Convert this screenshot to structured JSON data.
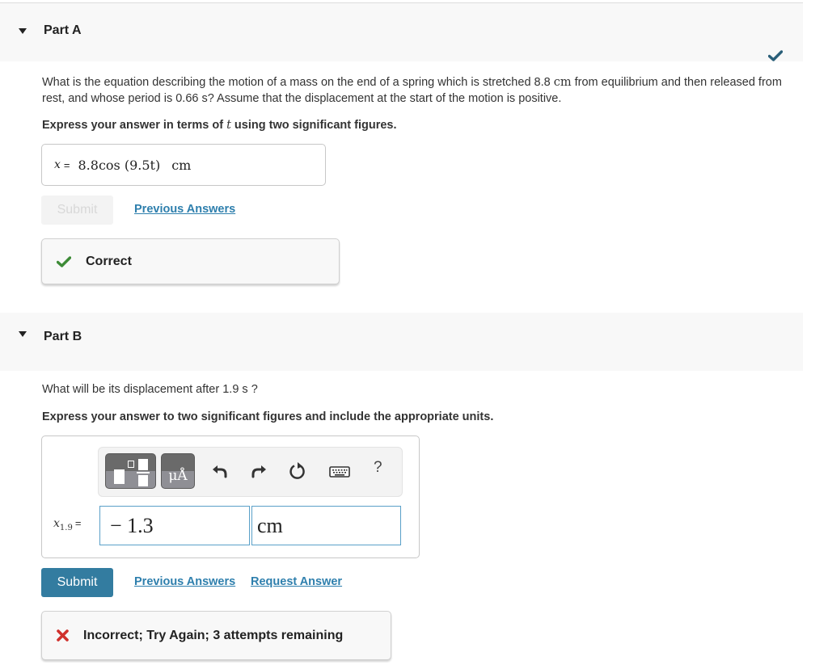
{
  "partA": {
    "title": "Part A",
    "completed": true,
    "question_pre": "What is the equation describing the motion of a mass on the end of a spring which is stretched 8.8 ",
    "question_unit1": "cm",
    "question_mid": " from equilibrium and then released from rest, and whose period is 0.66 ",
    "question_unit2": "s",
    "question_post": "? Assume that the displacement at the start of the motion is positive.",
    "instruction_pre": "Express your answer in terms of ",
    "instruction_var": "t",
    "instruction_post": " using two significant figures.",
    "answer_lhs": "x",
    "answer_eq": "=",
    "answer_expr": "8.8cos (9.5t)",
    "answer_unit": "cm",
    "submit_label": "Submit",
    "previous_answers_label": "Previous Answers",
    "feedback": "Correct",
    "feedback_status": "correct",
    "colors": {
      "check": "#2a5f79",
      "correct": "#3d8b37"
    }
  },
  "partB": {
    "title": "Part B",
    "question_pre": "What will be its displacement after 1.9 ",
    "question_unit": "s",
    "question_post": " ?",
    "instruction": "Express your answer to two significant figures and include the appropriate units.",
    "toolbar": {
      "templates_icon": "templates-icon",
      "units_label": "μÅ",
      "undo_icon": "undo-icon",
      "redo_icon": "redo-icon",
      "reset_icon": "reset-icon",
      "keyboard_icon": "keyboard-icon",
      "help_label": "?"
    },
    "var_name": "x",
    "var_sub": "1.9",
    "var_eq": "=",
    "value": "− 1.3",
    "unit": "cm",
    "submit_label": "Submit",
    "previous_answers_label": "Previous Answers",
    "request_answer_label": "Request Answer",
    "feedback": "Incorrect; Try Again; 3 attempts remaining",
    "feedback_status": "incorrect",
    "attempts_remaining": 3,
    "colors": {
      "submit": "#337ca0",
      "incorrect": "#d0312d",
      "input_border": "#5aa0c8"
    }
  }
}
